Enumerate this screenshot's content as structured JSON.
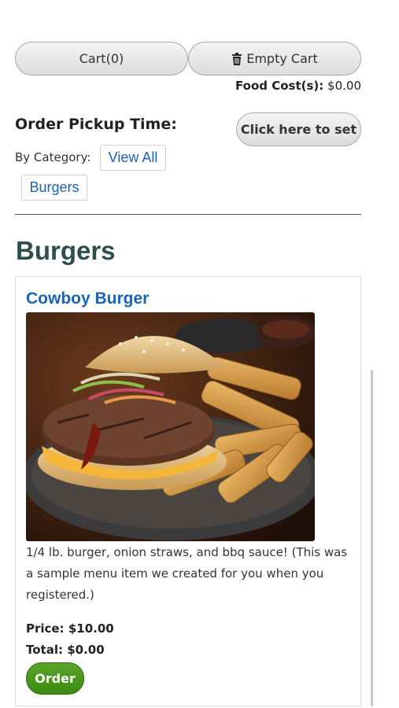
{
  "cart": {
    "label": "Cart(0)"
  },
  "empty_cart": {
    "label": "Empty Cart",
    "icon": "trash-icon"
  },
  "food_cost": {
    "label": "Food Cost(s):",
    "value": "$0.00"
  },
  "pickup": {
    "title": "Order Pickup Time:",
    "button_label": "Click here to set"
  },
  "category_filter": {
    "label": "By Category:",
    "options": [
      "View All",
      "Burgers"
    ]
  },
  "section": {
    "title": "Burgers"
  },
  "item": {
    "name": "Cowboy Burger",
    "description": "1/4 lb. burger, onion straws, and bbq sauce! (This was a sample menu item we created for you when you registered.)",
    "price": "Price: $10.00",
    "total": "Total: $0.00",
    "order_label": "Order"
  },
  "colors": {
    "link": "#1a64b8",
    "heading": "#2d4f4c",
    "order_button": "#3c8a12"
  }
}
